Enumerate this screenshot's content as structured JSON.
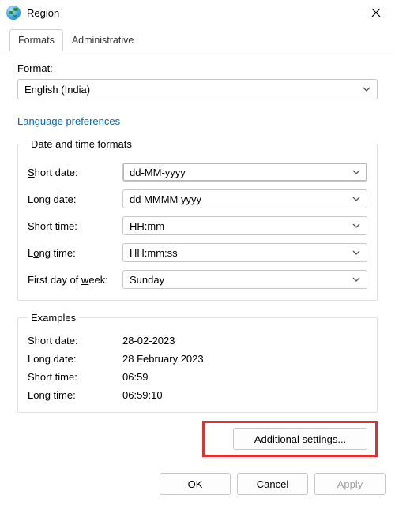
{
  "titlebar": {
    "title": "Region"
  },
  "tabs": {
    "formats": "Formats",
    "administrative": "Administrative"
  },
  "format_section": {
    "label_pre": "F",
    "label_post": "ormat:"
  },
  "format_combo": {
    "value": "English (India)"
  },
  "language_link": "Language preferences",
  "dtgroup": {
    "legend": "Date and time formats",
    "rows": {
      "short_date": {
        "label_pre": "",
        "label_u": "S",
        "label_post": "hort date:",
        "value": "dd-MM-yyyy"
      },
      "long_date": {
        "label_pre": "",
        "label_u": "L",
        "label_post": "ong date:",
        "value": "dd MMMM yyyy"
      },
      "short_time": {
        "label_pre": "S",
        "label_u": "h",
        "label_post": "ort time:",
        "value": "HH:mm"
      },
      "long_time": {
        "label_pre": "L",
        "label_u": "o",
        "label_post": "ng time:",
        "value": "HH:mm:ss"
      },
      "first_day": {
        "label_pre": "First day of ",
        "label_u": "w",
        "label_post": "eek:",
        "value": "Sunday"
      }
    }
  },
  "examples": {
    "legend": "Examples",
    "rows": {
      "short_date": {
        "label": "Short date:",
        "value": "28-02-2023"
      },
      "long_date": {
        "label": "Long date:",
        "value": "28 February 2023"
      },
      "short_time": {
        "label": "Short time:",
        "value": "06:59"
      },
      "long_time": {
        "label": "Long time:",
        "value": "06:59:10"
      }
    }
  },
  "additional_btn": {
    "pre": "A",
    "u": "d",
    "post": "ditional settings..."
  },
  "footer": {
    "ok": "OK",
    "cancel": "Cancel",
    "apply_pre": "",
    "apply_u": "A",
    "apply_post": "pply"
  }
}
